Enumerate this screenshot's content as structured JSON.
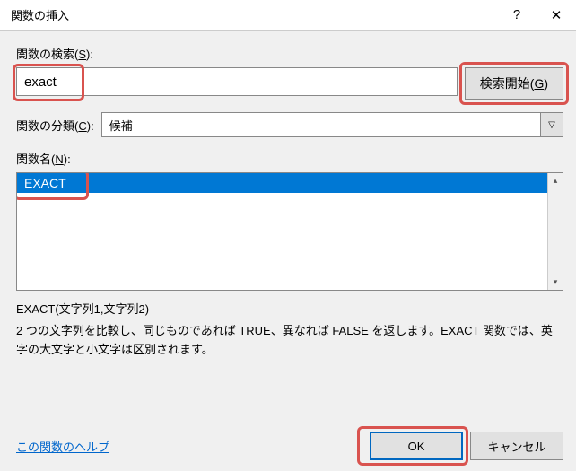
{
  "titlebar": {
    "title": "関数の挿入",
    "help": "?",
    "close": "✕"
  },
  "search": {
    "label_pre": "関数の検索(",
    "label_key": "S",
    "label_post": "):",
    "value": "exact",
    "go_label_pre": "検索開始(",
    "go_label_key": "G",
    "go_label_post": ")"
  },
  "category": {
    "label_pre": "関数の分類(",
    "label_key": "C",
    "label_post": "):",
    "value": "候補"
  },
  "function_list": {
    "label_pre": "関数名(",
    "label_key": "N",
    "label_post": "):",
    "items": [
      "EXACT"
    ],
    "selected_index": 0
  },
  "detail": {
    "syntax": "EXACT(文字列1,文字列2)",
    "description": "2 つの文字列を比較し、同じものであれば TRUE、異なれば FALSE を返します。EXACT 関数では、英字の大文字と小文字は区別されます。"
  },
  "footer": {
    "help_link": "この関数のヘルプ",
    "ok": "OK",
    "cancel": "キャンセル"
  }
}
